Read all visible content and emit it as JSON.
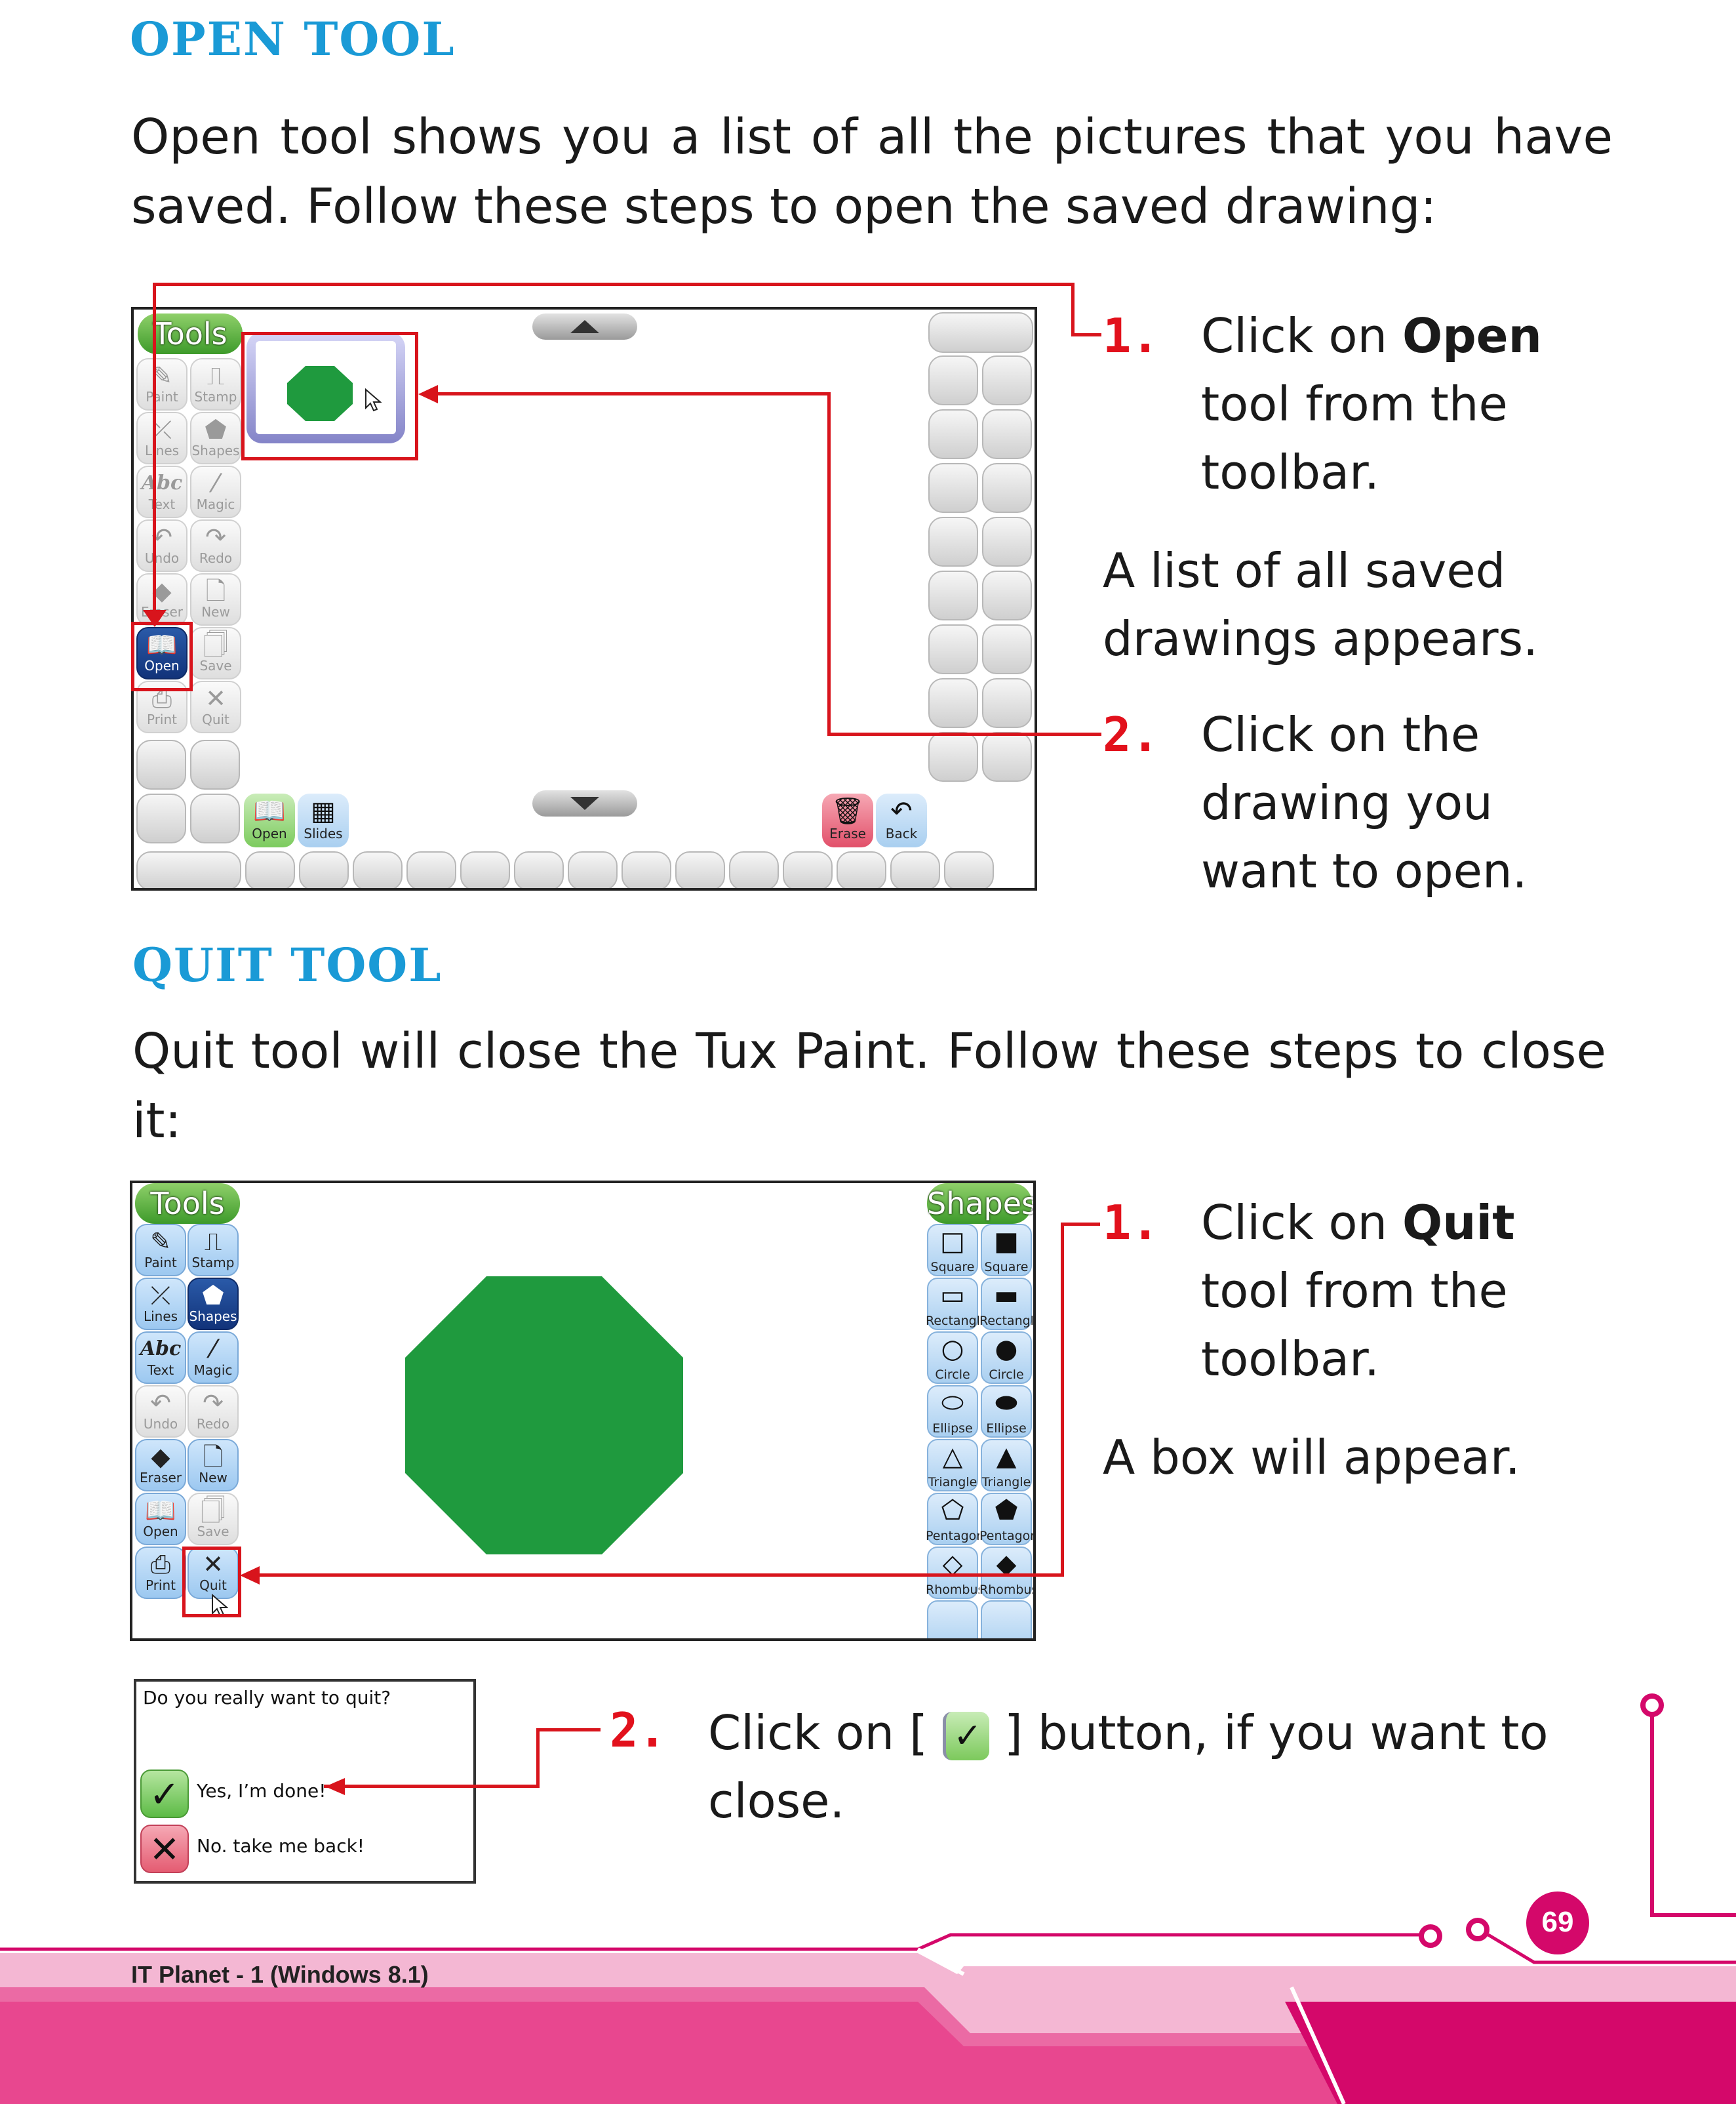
{
  "open_section": {
    "heading": "OPEN TOOL",
    "intro_line1": "Open tool shows you a list of all the pictures that you have",
    "intro_line2": "saved. Follow these steps to open the saved drawing:",
    "step1_number": "1.",
    "step1_line1_pre": "Click on ",
    "step1_line1_bold": "Open",
    "step1_line2": "tool  from the",
    "step1_line3": "toolbar.",
    "note_line1": "A list of all saved",
    "note_line2": "drawings appears.",
    "step2_number": "2.",
    "step2_line1": "Click on the",
    "step2_line2": "drawing you",
    "step2_line3": "want to open."
  },
  "quit_section": {
    "heading": "QUIT TOOL",
    "intro_line1": "Quit tool will close the Tux Paint. Follow these steps to close",
    "intro_line2": "it:",
    "step1_number": "1.",
    "step1_line1_pre": "Click on ",
    "step1_line1_bold": "Quit",
    "step1_line2": "tool from the",
    "step1_line3": "toolbar.",
    "note_line1": "A box will appear.",
    "step2_number": "2.",
    "step2_line1_pre": "Click on [ ",
    "step2_line1_post": " ] button, if you want to",
    "step2_line2": "close."
  },
  "screenshot_open": {
    "tools_label": "Tools",
    "tools": [
      {
        "label": "Paint",
        "icon": "brush-icon",
        "glyph": "✎"
      },
      {
        "label": "Stamp",
        "icon": "stamp-icon",
        "glyph": "⎍"
      },
      {
        "label": "Lines",
        "icon": "lines-icon",
        "glyph": "⤫"
      },
      {
        "label": "Shapes",
        "icon": "shapes-icon",
        "glyph": "⬟"
      },
      {
        "label": "Text",
        "icon": "text-icon",
        "glyph": "Abc"
      },
      {
        "label": "Magic",
        "icon": "magic-wand-icon",
        "glyph": "⁄"
      },
      {
        "label": "Undo",
        "icon": "undo-icon",
        "glyph": "↶"
      },
      {
        "label": "Redo",
        "icon": "redo-icon",
        "glyph": "↷"
      },
      {
        "label": "Eraser",
        "icon": "eraser-icon",
        "glyph": "◆"
      },
      {
        "label": "New",
        "icon": "new-page-icon",
        "glyph": "🗋"
      },
      {
        "label": "Open",
        "icon": "open-book-icon",
        "glyph": "📖"
      },
      {
        "label": "Save",
        "icon": "save-icon",
        "glyph": "🗍"
      },
      {
        "label": "Print",
        "icon": "printer-icon",
        "glyph": "⎙"
      },
      {
        "label": "Quit",
        "icon": "quit-x-icon",
        "glyph": "✕"
      }
    ],
    "bottom_buttons": [
      {
        "label": "Open",
        "icon": "open-book-icon",
        "glyph": "📖"
      },
      {
        "label": "Slides",
        "icon": "slides-icon",
        "glyph": "▦"
      },
      {
        "label": "Erase",
        "icon": "trash-icon",
        "glyph": "🗑"
      },
      {
        "label": "Back",
        "icon": "back-arrow-icon",
        "glyph": "↶"
      }
    ]
  },
  "screenshot_quit": {
    "tools_label": "Tools",
    "shapes_label": "Shapes",
    "tools": [
      {
        "label": "Paint",
        "icon": "brush-icon",
        "glyph": "✎"
      },
      {
        "label": "Stamp",
        "icon": "stamp-icon",
        "glyph": "⎍"
      },
      {
        "label": "Lines",
        "icon": "lines-icon",
        "glyph": "⤫"
      },
      {
        "label": "Shapes",
        "icon": "shapes-icon",
        "glyph": "⬟"
      },
      {
        "label": "Text",
        "icon": "text-icon",
        "glyph": "Abc"
      },
      {
        "label": "Magic",
        "icon": "magic-wand-icon",
        "glyph": "⁄"
      },
      {
        "label": "Undo",
        "icon": "undo-icon",
        "glyph": "↶"
      },
      {
        "label": "Redo",
        "icon": "redo-icon",
        "glyph": "↷"
      },
      {
        "label": "Eraser",
        "icon": "eraser-icon",
        "glyph": "◆"
      },
      {
        "label": "New",
        "icon": "new-page-icon",
        "glyph": "🗋"
      },
      {
        "label": "Open",
        "icon": "open-book-icon",
        "glyph": "📖"
      },
      {
        "label": "Save",
        "icon": "save-icon",
        "glyph": "🗍"
      },
      {
        "label": "Print",
        "icon": "printer-icon",
        "glyph": "⎙"
      },
      {
        "label": "Quit",
        "icon": "quit-x-icon",
        "glyph": "✕"
      }
    ],
    "shapes": [
      {
        "label": "Square",
        "glyph": "□"
      },
      {
        "label": "Square",
        "glyph": "■"
      },
      {
        "label": "Rectangle",
        "glyph": "▭"
      },
      {
        "label": "Rectangle",
        "glyph": "▬"
      },
      {
        "label": "Circle",
        "glyph": "○"
      },
      {
        "label": "Circle",
        "glyph": "●"
      },
      {
        "label": "Ellipse",
        "glyph": "⬭"
      },
      {
        "label": "Ellipse",
        "glyph": "⬬"
      },
      {
        "label": "Triangle",
        "glyph": "△"
      },
      {
        "label": "Triangle",
        "glyph": "▲"
      },
      {
        "label": "Pentagon",
        "glyph": "⬠"
      },
      {
        "label": "Pentagon",
        "glyph": "⬟"
      },
      {
        "label": "Rhombus",
        "glyph": "◇"
      },
      {
        "label": "Rhombus",
        "glyph": "◆"
      }
    ]
  },
  "quit_dialog": {
    "question": "Do you really want to quit?",
    "yes_label": "Yes, I’m done!",
    "no_label": "No. take me back!"
  },
  "colors": {
    "heading": "#1a9ad6",
    "step_number": "#e2111c",
    "callout": "#d8141c",
    "footer_pink": "#e8478f",
    "footer_magenta": "#d4086a",
    "octagon_green": "#1f9a3e"
  },
  "footer": {
    "book_title": "IT Planet - 1 (Windows 8.1)",
    "page_number": "69"
  }
}
